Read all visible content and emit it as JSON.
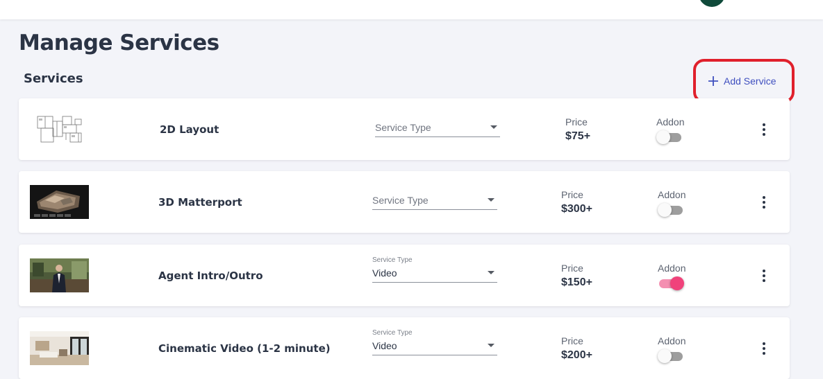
{
  "header": {
    "page_title": "Manage Services"
  },
  "section": {
    "title": "Services",
    "add_button_label": "Add Service"
  },
  "table_labels": {
    "price": "Price",
    "addon": "Addon"
  },
  "services": [
    {
      "name": "2D Layout",
      "service_type_label": "",
      "service_type_value": "Service Type",
      "price": "$75+",
      "addon": false,
      "thumbnail": "floorplan-thumbnail"
    },
    {
      "name": "3D Matterport",
      "service_type_label": "",
      "service_type_value": "Service Type",
      "price": "$300+",
      "addon": false,
      "thumbnail": "matterport-thumbnail"
    },
    {
      "name": "Agent Intro/Outro",
      "service_type_label": "Service Type",
      "service_type_value": "Video",
      "price": "$150+",
      "addon": true,
      "thumbnail": "agent-video-thumbnail"
    },
    {
      "name": "Cinematic Video (1-2 minute)",
      "service_type_label": "Service Type",
      "service_type_value": "Video",
      "price": "$200+",
      "addon": false,
      "thumbnail": "interior-thumbnail"
    }
  ],
  "colors": {
    "accent": "#3f4fbf",
    "highlight": "#e0202c",
    "toggle_on": "#f0427b",
    "background": "#f3f4f9"
  }
}
